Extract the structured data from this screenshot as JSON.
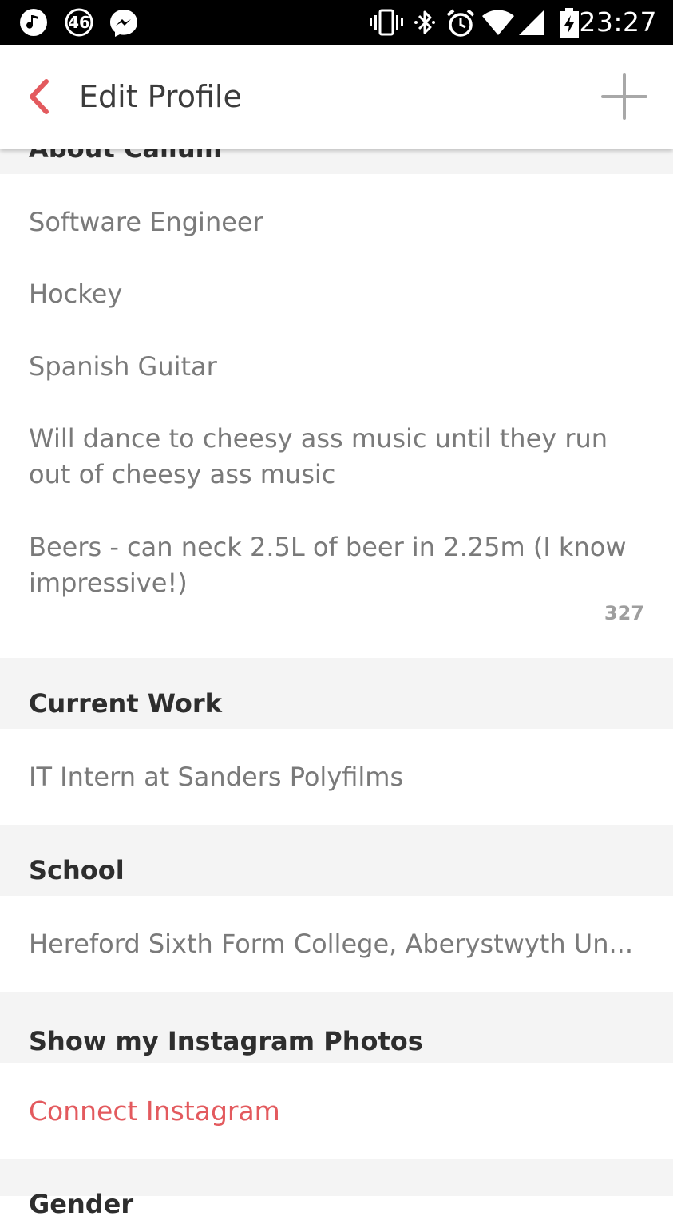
{
  "status_bar": {
    "time": "23:27",
    "notification_badge": "46",
    "left_icons": [
      "music-note-icon",
      "badge-46-icon",
      "messenger-icon"
    ],
    "right_icons": [
      "vibrate-icon",
      "bluetooth-icon",
      "alarm-icon",
      "wifi-icon",
      "signal-icon",
      "battery-charging-icon"
    ]
  },
  "header": {
    "title": "Edit Profile",
    "accent_color": "#e35a5e"
  },
  "about": {
    "section_title_partial": "About Callum",
    "lines": [
      "Software Engineer",
      "Hockey",
      "Spanish Guitar",
      "Will dance to cheesy ass music until they run out of cheesy ass music",
      "Beers - can neck 2.5L of beer in 2.25m (I know impressive!)"
    ],
    "char_counter": "327"
  },
  "current_work": {
    "title": "Current Work",
    "value": "IT Intern at Sanders Polyfilms"
  },
  "school": {
    "title": "School",
    "value": "Hereford Sixth Form College, Aberystwyth Un..."
  },
  "instagram": {
    "title": "Show my Instagram Photos",
    "connect_label": "Connect Instagram"
  },
  "next_section": {
    "title_partial": "Gender"
  }
}
